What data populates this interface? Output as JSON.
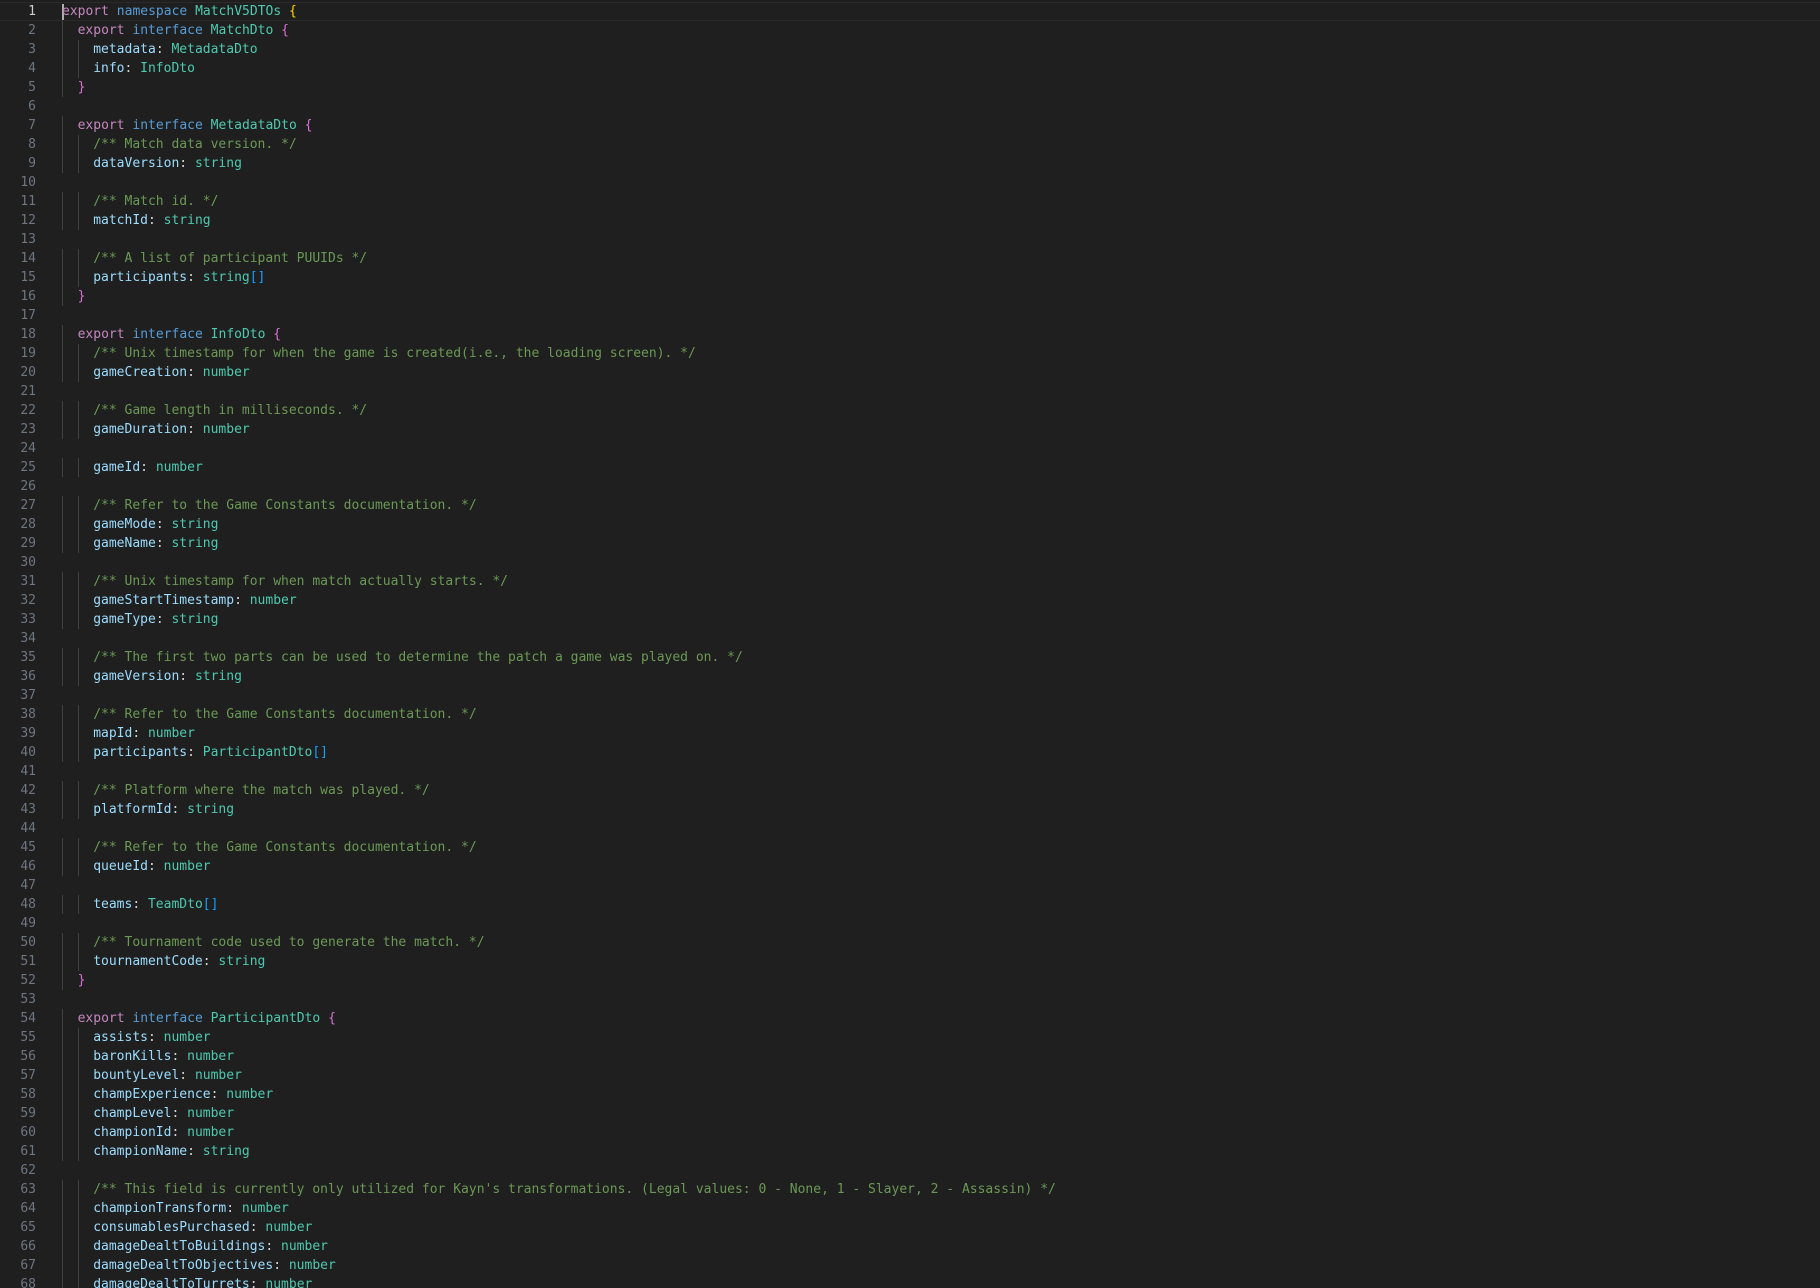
{
  "colors": {
    "kw": "#c586c0",
    "decl": "#569cd6",
    "type": "#4ec9b0",
    "prop": "#9cdcfe",
    "punc": "#d4d4d4",
    "comment": "#6a9955",
    "brace1": "#ffd700",
    "brace2": "#da70d6",
    "brace3": "#179fff"
  },
  "editor": {
    "active_line": 1,
    "lines": [
      {
        "n": "1",
        "indent": 0,
        "tokens": [
          [
            "export ",
            "kw"
          ],
          [
            "namespace ",
            "decl"
          ],
          [
            "MatchV5DTOs ",
            "type"
          ],
          [
            "{",
            "brace1"
          ]
        ]
      },
      {
        "n": "2",
        "indent": 1,
        "tokens": [
          [
            "export ",
            "kw"
          ],
          [
            "interface ",
            "decl"
          ],
          [
            "MatchDto ",
            "type"
          ],
          [
            "{",
            "brace2"
          ]
        ]
      },
      {
        "n": "3",
        "indent": 2,
        "tokens": [
          [
            "metadata",
            "prop"
          ],
          [
            ": ",
            "punc"
          ],
          [
            "MetadataDto",
            "type"
          ]
        ]
      },
      {
        "n": "4",
        "indent": 2,
        "tokens": [
          [
            "info",
            "prop"
          ],
          [
            ": ",
            "punc"
          ],
          [
            "InfoDto",
            "type"
          ]
        ]
      },
      {
        "n": "5",
        "indent": 1,
        "tokens": [
          [
            "}",
            "brace2"
          ]
        ]
      },
      {
        "n": "6",
        "indent": 0,
        "tokens": []
      },
      {
        "n": "7",
        "indent": 1,
        "tokens": [
          [
            "export ",
            "kw"
          ],
          [
            "interface ",
            "decl"
          ],
          [
            "MetadataDto ",
            "type"
          ],
          [
            "{",
            "brace2"
          ]
        ]
      },
      {
        "n": "8",
        "indent": 2,
        "tokens": [
          [
            "/** Match data version. */",
            "comment"
          ]
        ]
      },
      {
        "n": "9",
        "indent": 2,
        "tokens": [
          [
            "dataVersion",
            "prop"
          ],
          [
            ": ",
            "punc"
          ],
          [
            "string",
            "type"
          ]
        ]
      },
      {
        "n": "10",
        "indent": 0,
        "tokens": []
      },
      {
        "n": "11",
        "indent": 2,
        "tokens": [
          [
            "/** Match id. */",
            "comment"
          ]
        ]
      },
      {
        "n": "12",
        "indent": 2,
        "tokens": [
          [
            "matchId",
            "prop"
          ],
          [
            ": ",
            "punc"
          ],
          [
            "string",
            "type"
          ]
        ]
      },
      {
        "n": "13",
        "indent": 0,
        "tokens": []
      },
      {
        "n": "14",
        "indent": 2,
        "tokens": [
          [
            "/** A list of participant PUUIDs */",
            "comment"
          ]
        ]
      },
      {
        "n": "15",
        "indent": 2,
        "tokens": [
          [
            "participants",
            "prop"
          ],
          [
            ": ",
            "punc"
          ],
          [
            "string",
            "type"
          ],
          [
            "[]",
            "brace3"
          ]
        ]
      },
      {
        "n": "16",
        "indent": 1,
        "tokens": [
          [
            "}",
            "brace2"
          ]
        ]
      },
      {
        "n": "17",
        "indent": 0,
        "tokens": []
      },
      {
        "n": "18",
        "indent": 1,
        "tokens": [
          [
            "export ",
            "kw"
          ],
          [
            "interface ",
            "decl"
          ],
          [
            "InfoDto ",
            "type"
          ],
          [
            "{",
            "brace2"
          ]
        ]
      },
      {
        "n": "19",
        "indent": 2,
        "tokens": [
          [
            "/** Unix timestamp for when the game is created(i.e., the loading screen). */",
            "comment"
          ]
        ]
      },
      {
        "n": "20",
        "indent": 2,
        "tokens": [
          [
            "gameCreation",
            "prop"
          ],
          [
            ": ",
            "punc"
          ],
          [
            "number",
            "type"
          ]
        ]
      },
      {
        "n": "21",
        "indent": 0,
        "tokens": []
      },
      {
        "n": "22",
        "indent": 2,
        "tokens": [
          [
            "/** Game length in milliseconds. */",
            "comment"
          ]
        ]
      },
      {
        "n": "23",
        "indent": 2,
        "tokens": [
          [
            "gameDuration",
            "prop"
          ],
          [
            ": ",
            "punc"
          ],
          [
            "number",
            "type"
          ]
        ]
      },
      {
        "n": "24",
        "indent": 0,
        "tokens": []
      },
      {
        "n": "25",
        "indent": 2,
        "tokens": [
          [
            "gameId",
            "prop"
          ],
          [
            ": ",
            "punc"
          ],
          [
            "number",
            "type"
          ]
        ]
      },
      {
        "n": "26",
        "indent": 0,
        "tokens": []
      },
      {
        "n": "27",
        "indent": 2,
        "tokens": [
          [
            "/** Refer to the Game Constants documentation. */",
            "comment"
          ]
        ]
      },
      {
        "n": "28",
        "indent": 2,
        "tokens": [
          [
            "gameMode",
            "prop"
          ],
          [
            ": ",
            "punc"
          ],
          [
            "string",
            "type"
          ]
        ]
      },
      {
        "n": "29",
        "indent": 2,
        "tokens": [
          [
            "gameName",
            "prop"
          ],
          [
            ": ",
            "punc"
          ],
          [
            "string",
            "type"
          ]
        ]
      },
      {
        "n": "30",
        "indent": 0,
        "tokens": []
      },
      {
        "n": "31",
        "indent": 2,
        "tokens": [
          [
            "/** Unix timestamp for when match actually starts. */",
            "comment"
          ]
        ]
      },
      {
        "n": "32",
        "indent": 2,
        "tokens": [
          [
            "gameStartTimestamp",
            "prop"
          ],
          [
            ": ",
            "punc"
          ],
          [
            "number",
            "type"
          ]
        ]
      },
      {
        "n": "33",
        "indent": 2,
        "tokens": [
          [
            "gameType",
            "prop"
          ],
          [
            ": ",
            "punc"
          ],
          [
            "string",
            "type"
          ]
        ]
      },
      {
        "n": "34",
        "indent": 0,
        "tokens": []
      },
      {
        "n": "35",
        "indent": 2,
        "tokens": [
          [
            "/** The first two parts can be used to determine the patch a game was played on. */",
            "comment"
          ]
        ]
      },
      {
        "n": "36",
        "indent": 2,
        "tokens": [
          [
            "gameVersion",
            "prop"
          ],
          [
            ": ",
            "punc"
          ],
          [
            "string",
            "type"
          ]
        ]
      },
      {
        "n": "37",
        "indent": 0,
        "tokens": []
      },
      {
        "n": "38",
        "indent": 2,
        "tokens": [
          [
            "/** Refer to the Game Constants documentation. */",
            "comment"
          ]
        ]
      },
      {
        "n": "39",
        "indent": 2,
        "tokens": [
          [
            "mapId",
            "prop"
          ],
          [
            ": ",
            "punc"
          ],
          [
            "number",
            "type"
          ]
        ]
      },
      {
        "n": "40",
        "indent": 2,
        "tokens": [
          [
            "participants",
            "prop"
          ],
          [
            ": ",
            "punc"
          ],
          [
            "ParticipantDto",
            "type"
          ],
          [
            "[]",
            "brace3"
          ]
        ]
      },
      {
        "n": "41",
        "indent": 0,
        "tokens": []
      },
      {
        "n": "42",
        "indent": 2,
        "tokens": [
          [
            "/** Platform where the match was played. */",
            "comment"
          ]
        ]
      },
      {
        "n": "43",
        "indent": 2,
        "tokens": [
          [
            "platformId",
            "prop"
          ],
          [
            ": ",
            "punc"
          ],
          [
            "string",
            "type"
          ]
        ]
      },
      {
        "n": "44",
        "indent": 0,
        "tokens": []
      },
      {
        "n": "45",
        "indent": 2,
        "tokens": [
          [
            "/** Refer to the Game Constants documentation. */",
            "comment"
          ]
        ]
      },
      {
        "n": "46",
        "indent": 2,
        "tokens": [
          [
            "queueId",
            "prop"
          ],
          [
            ": ",
            "punc"
          ],
          [
            "number",
            "type"
          ]
        ]
      },
      {
        "n": "47",
        "indent": 0,
        "tokens": []
      },
      {
        "n": "48",
        "indent": 2,
        "tokens": [
          [
            "teams",
            "prop"
          ],
          [
            ": ",
            "punc"
          ],
          [
            "TeamDto",
            "type"
          ],
          [
            "[]",
            "brace3"
          ]
        ]
      },
      {
        "n": "49",
        "indent": 0,
        "tokens": []
      },
      {
        "n": "50",
        "indent": 2,
        "tokens": [
          [
            "/** Tournament code used to generate the match. */",
            "comment"
          ]
        ]
      },
      {
        "n": "51",
        "indent": 2,
        "tokens": [
          [
            "tournamentCode",
            "prop"
          ],
          [
            ": ",
            "punc"
          ],
          [
            "string",
            "type"
          ]
        ]
      },
      {
        "n": "52",
        "indent": 1,
        "tokens": [
          [
            "}",
            "brace2"
          ]
        ]
      },
      {
        "n": "53",
        "indent": 0,
        "tokens": []
      },
      {
        "n": "54",
        "indent": 1,
        "tokens": [
          [
            "export ",
            "kw"
          ],
          [
            "interface ",
            "decl"
          ],
          [
            "ParticipantDto ",
            "type"
          ],
          [
            "{",
            "brace2"
          ]
        ]
      },
      {
        "n": "55",
        "indent": 2,
        "tokens": [
          [
            "assists",
            "prop"
          ],
          [
            ": ",
            "punc"
          ],
          [
            "number",
            "type"
          ]
        ]
      },
      {
        "n": "56",
        "indent": 2,
        "tokens": [
          [
            "baronKills",
            "prop"
          ],
          [
            ": ",
            "punc"
          ],
          [
            "number",
            "type"
          ]
        ]
      },
      {
        "n": "57",
        "indent": 2,
        "tokens": [
          [
            "bountyLevel",
            "prop"
          ],
          [
            ": ",
            "punc"
          ],
          [
            "number",
            "type"
          ]
        ]
      },
      {
        "n": "58",
        "indent": 2,
        "tokens": [
          [
            "champExperience",
            "prop"
          ],
          [
            ": ",
            "punc"
          ],
          [
            "number",
            "type"
          ]
        ]
      },
      {
        "n": "59",
        "indent": 2,
        "tokens": [
          [
            "champLevel",
            "prop"
          ],
          [
            ": ",
            "punc"
          ],
          [
            "number",
            "type"
          ]
        ]
      },
      {
        "n": "60",
        "indent": 2,
        "tokens": [
          [
            "championId",
            "prop"
          ],
          [
            ": ",
            "punc"
          ],
          [
            "number",
            "type"
          ]
        ]
      },
      {
        "n": "61",
        "indent": 2,
        "tokens": [
          [
            "championName",
            "prop"
          ],
          [
            ": ",
            "punc"
          ],
          [
            "string",
            "type"
          ]
        ]
      },
      {
        "n": "62",
        "indent": 0,
        "tokens": []
      },
      {
        "n": "63",
        "indent": 2,
        "tokens": [
          [
            "/** This field is currently only utilized for Kayn's transformations. (Legal values: 0 - None, 1 - Slayer, 2 - Assassin) */",
            "comment"
          ]
        ]
      },
      {
        "n": "64",
        "indent": 2,
        "tokens": [
          [
            "championTransform",
            "prop"
          ],
          [
            ": ",
            "punc"
          ],
          [
            "number",
            "type"
          ]
        ]
      },
      {
        "n": "65",
        "indent": 2,
        "tokens": [
          [
            "consumablesPurchased",
            "prop"
          ],
          [
            ": ",
            "punc"
          ],
          [
            "number",
            "type"
          ]
        ]
      },
      {
        "n": "66",
        "indent": 2,
        "tokens": [
          [
            "damageDealtToBuildings",
            "prop"
          ],
          [
            ": ",
            "punc"
          ],
          [
            "number",
            "type"
          ]
        ]
      },
      {
        "n": "67",
        "indent": 2,
        "tokens": [
          [
            "damageDealtToObjectives",
            "prop"
          ],
          [
            ": ",
            "punc"
          ],
          [
            "number",
            "type"
          ]
        ]
      },
      {
        "n": "68",
        "indent": 2,
        "tokens": [
          [
            "damageDealtToTurrets",
            "prop"
          ],
          [
            ": ",
            "punc"
          ],
          [
            "number",
            "type"
          ]
        ]
      }
    ]
  }
}
